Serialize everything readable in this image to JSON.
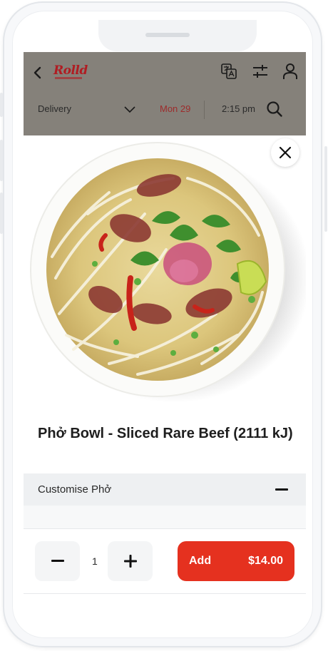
{
  "brand": {
    "logo_text": "Rolld"
  },
  "header": {
    "order_type": "Delivery",
    "date": "Mon 29",
    "time": "2:15 pm",
    "icons": [
      "back-icon",
      "translate-icon",
      "filter-icon",
      "user-icon",
      "chevron-down-icon",
      "search-icon"
    ]
  },
  "product": {
    "title": "Phở Bowl - Sliced Rare Beef (2111 kJ)",
    "customise_label": "Customise Phở"
  },
  "cart": {
    "quantity": "1",
    "add_label": "Add",
    "price": "$14.00"
  },
  "colors": {
    "header_bg": "#85817a",
    "brand_red": "#b01c22",
    "accent_red": "#e5311f",
    "date_color": "#9d2b2b"
  }
}
